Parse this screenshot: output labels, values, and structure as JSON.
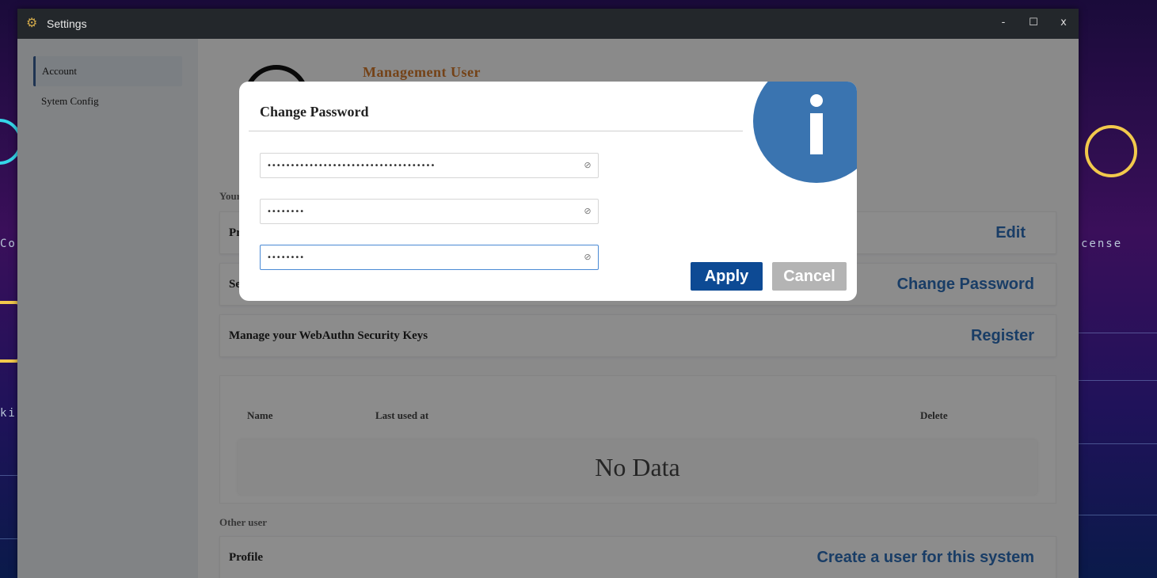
{
  "window": {
    "title": "Settings",
    "controls": {
      "minimize": "-",
      "maximize": "☐",
      "close": "x"
    }
  },
  "sidebar": {
    "items": [
      {
        "label": "Account",
        "active": true
      },
      {
        "label": "Sytem Config",
        "active": false
      }
    ]
  },
  "account": {
    "user_title": "Management User",
    "your_section_label": "Your",
    "rows": [
      {
        "label": "Pr",
        "action": "Edit"
      },
      {
        "label": "Se",
        "action": "Change Password"
      },
      {
        "label": "Manage your WebAuthn Security Keys",
        "action": "Register"
      }
    ],
    "keys_table": {
      "columns": [
        "Name",
        "Last used at",
        "Delete"
      ],
      "empty_text": "No Data"
    },
    "other_user_label": "Other user",
    "other_user_row": {
      "label": "Profile",
      "action": "Create a user for this system"
    }
  },
  "modal": {
    "title": "Change Password",
    "fields": [
      {
        "value": "••••••••••••••••••••••••••••••••••••"
      },
      {
        "value": "••••••••"
      },
      {
        "value": "••••••••"
      }
    ],
    "apply_label": "Apply",
    "cancel_label": "Cancel",
    "icon": "info-icon",
    "accent_color": "#0d4a94"
  },
  "background": {
    "texts": [
      "Co",
      "cense",
      "kin"
    ]
  }
}
